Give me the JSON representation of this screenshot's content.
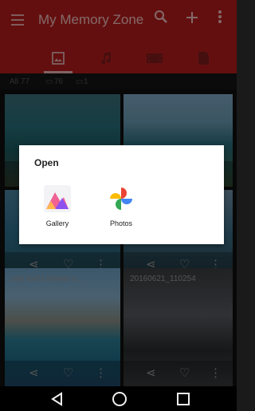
{
  "appbar": {
    "title": "My Memory Zone"
  },
  "tabs": [
    {
      "name": "photos",
      "icon": "image-icon"
    },
    {
      "name": "music",
      "icon": "music-icon"
    },
    {
      "name": "video",
      "icon": "video-icon"
    },
    {
      "name": "documents",
      "icon": "document-icon"
    }
  ],
  "counts": {
    "all": "All 77",
    "photos": "76",
    "videos": "1"
  },
  "tiles": [
    {
      "caption": ""
    },
    {
      "caption": ""
    },
    {
      "caption": ""
    },
    {
      "caption": ""
    },
    {
      "caption": "usa toul's hawaii o..."
    },
    {
      "caption": "20160621_110254"
    }
  ],
  "dialog": {
    "title": "Open",
    "options": [
      {
        "label": "Gallery",
        "icon": "gallery-icon"
      },
      {
        "label": "Photos",
        "icon": "google-photos-icon"
      }
    ]
  },
  "colors": {
    "appbar": "#b71c1c",
    "dialog": "#ffffff"
  }
}
